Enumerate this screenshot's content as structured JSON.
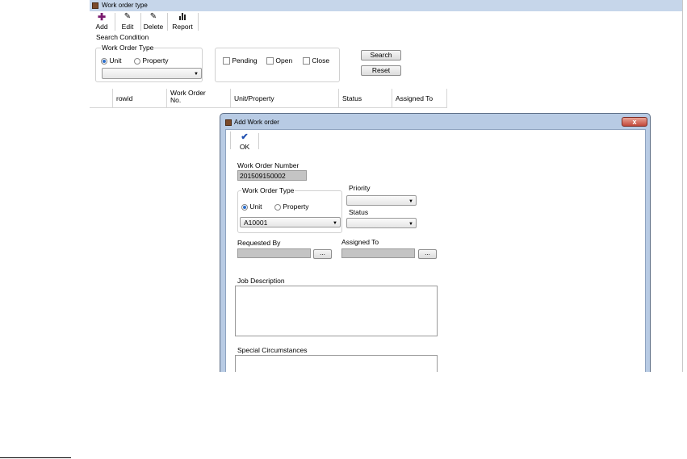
{
  "main_window": {
    "title": "Work order type",
    "toolbar": {
      "add": "Add",
      "edit": "Edit",
      "delete": "Delete",
      "report": "Report"
    },
    "search_condition_label": "Search Condition",
    "work_order_type": {
      "group_label": "Work Order Type",
      "option_unit": "Unit",
      "option_property": "Property",
      "selected": "Unit",
      "combo_value": ""
    },
    "status_filters": {
      "pending": "Pending",
      "open": "Open",
      "close": "Close"
    },
    "search_button": "Search",
    "reset_button": "Reset",
    "grid": {
      "columns": [
        "rowid",
        "Work Order No.",
        "Unit/Property",
        "Status",
        "Assigned To"
      ]
    }
  },
  "dialog": {
    "title": "Add Work order",
    "close_glyph": "x",
    "ok_label": "OK",
    "work_order_number_label": "Work Order Number",
    "work_order_number_value": "201509150002",
    "work_order_type": {
      "group_label": "Work Order Type",
      "option_unit": "Unit",
      "option_property": "Property",
      "selected": "Unit",
      "combo_value": "A10001"
    },
    "priority_label": "Priority",
    "priority_value": "",
    "status_label": "Status",
    "status_value": "",
    "requested_by_label": "Requested By",
    "requested_by_value": "",
    "assigned_to_label": "Assigned To",
    "assigned_to_value": "",
    "browse_label": "...",
    "job_description_label": "Job Description",
    "job_description_value": "",
    "special_circumstances_label": "Special Circumstances",
    "special_circumstances_value": ""
  },
  "colors": {
    "titlebar": "#c6d6ea",
    "dialog_frame": "#b8cbe4",
    "close_button": "#c2483a",
    "add_icon": "#7a1a6e",
    "ok_check": "#1f4fb0",
    "radio_selected": "#2b6dc9"
  },
  "icons": {
    "add": "plus-icon",
    "edit": "pencil-icon",
    "delete": "pencil-icon",
    "report": "bar-chart-icon",
    "ok": "checkmark-icon",
    "close": "close-icon"
  }
}
